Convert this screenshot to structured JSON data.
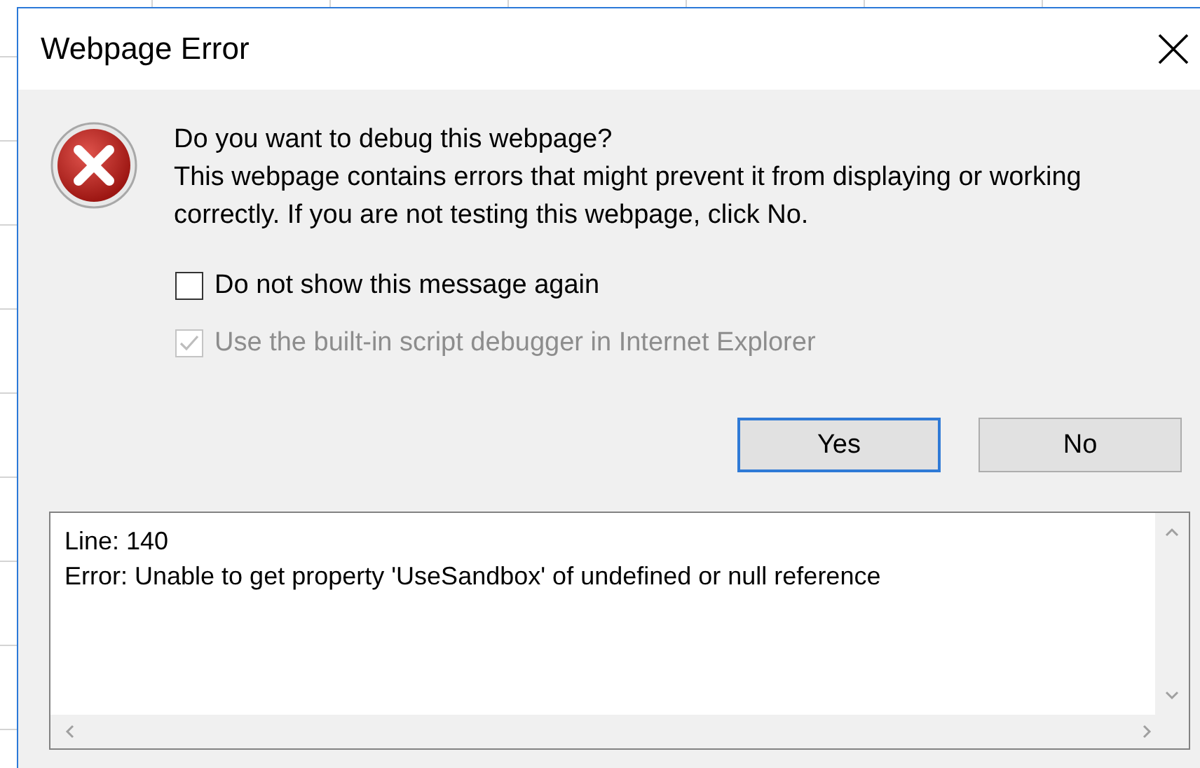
{
  "window": {
    "title": "Webpage Error"
  },
  "message": {
    "heading": "Do you want to debug this webpage?",
    "body": "This webpage contains errors that might prevent it from displaying or working correctly. If you are not testing this webpage, click No."
  },
  "checkboxes": [
    {
      "label": "Do not show this message again",
      "checked": false,
      "disabled": false
    },
    {
      "label": "Use the built-in script debugger in Internet Explorer",
      "checked": true,
      "disabled": true
    }
  ],
  "buttons": [
    {
      "label": "Yes",
      "default": true
    },
    {
      "label": "No",
      "default": false
    }
  ],
  "details": {
    "lines": [
      "Line: 140",
      "Error: Unable to get property 'UseSandbox' of undefined or null reference"
    ]
  }
}
